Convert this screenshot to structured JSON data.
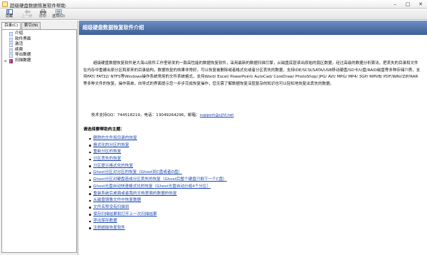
{
  "window": {
    "title": "超级硬盘数据恢复软件帮助",
    "controls": {
      "minimize": "–",
      "maximize": "□",
      "close": "✕"
    }
  },
  "toolbar": {
    "buttons": [
      {
        "label": "隐藏",
        "icon": "hide-icon",
        "enabled": true
      },
      {
        "label": "上一步",
        "icon": "back-icon",
        "enabled": false
      },
      {
        "label": "打印",
        "icon": "print-icon",
        "enabled": true
      },
      {
        "label": "选项(O)",
        "icon": "options-icon",
        "enabled": true
      }
    ]
  },
  "left_pane": {
    "tabs": [
      {
        "label": "目录(C)",
        "active": true
      },
      {
        "label": "索引(N)",
        "active": false
      }
    ],
    "tree": [
      {
        "label": "介绍",
        "type": "page"
      },
      {
        "label": "软件界面",
        "type": "page"
      },
      {
        "label": "激活",
        "type": "page"
      },
      {
        "label": "续费",
        "type": "page"
      },
      {
        "label": "导出数据",
        "type": "page"
      },
      {
        "label": "扫描数据",
        "type": "folder"
      }
    ]
  },
  "content": {
    "heading": "超级硬盘数据恢复软件介绍",
    "description": "超级硬盘数据恢复软件是大海山软件工作室研发的一款高性能的数据恢复软件，采用最新的数据扫描引擎，从磁盘底层读出原始的扇区数据，经过高级的数据分析算法，把丢失的目录和文件在内存中重建出原分区和原来的目录结构，数据恢复的效果非常好。可以恢复被删除或者格式化或者分区丢失的数据，支持IDE/SCSI/SATA/USB移动硬盘/SD卡/U盘/RAID磁盘等多种存储介质，支持FAT/ FAT32/ NTFS等Windows操作系统常用的文件系统格式，支持Word/ Excel/ PowerPoint/ AutoCad/ CoreDraw/ PhotoShop/ JPG/ AVI/ MPG/ MP4/ 3GP/ RMVB/ PDF/WAV/ZIP/RAR等多种文件的恢复。操作简单，向导式的界面提示您一步步完成恢复操作，您无需了解数据恢复深层复杂的知识也可以轻松地恢复出丢失的数据。",
    "contact_prefix": "技术支持QQ：744518219，电话：13049264296，邮箱：",
    "contact_email": "support@cjhf.net",
    "help_title": "请选择要帮助的主题：",
    "topics": [
      "删除的文件和目录的恢复",
      "格式化的分区的恢复",
      "重新分区的恢复",
      "分区丢失的恢复",
      "分区提示格式化的恢复",
      "Ghost分区对分区的恢复（Ghost到C盘或者D盘）",
      "Ghost分区对硬盘造成分区丢失的恢复（Ghost后整个硬盘只剩下一个C盘）",
      "Ghost光盘自动快速格式化的恢复（Ghost光盘自动分成4个分区）",
      "重装系统后桌面或者我的文档里面的数据的恢复",
      "从磁盘镜像文件中恢复数据",
      "文件名称没有扫描到",
      "保存扫描结果和打开上一次扫描结果",
      "导出保存数据",
      "注册超级恢复软件"
    ]
  }
}
